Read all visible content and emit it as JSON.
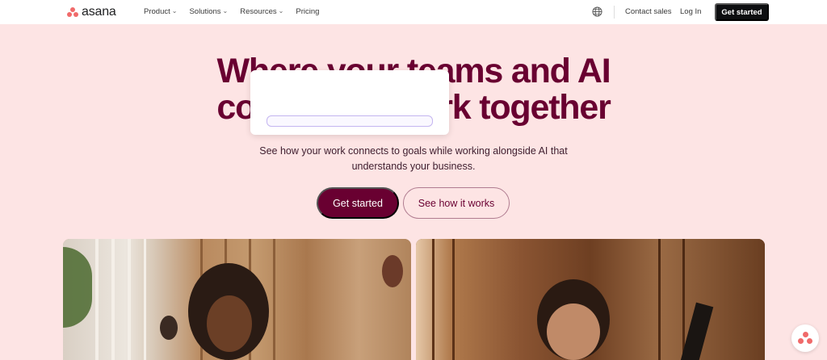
{
  "nav": {
    "logo_text": "asana",
    "links": [
      {
        "label": "Product",
        "has_dropdown": true
      },
      {
        "label": "Solutions",
        "has_dropdown": true
      },
      {
        "label": "Resources",
        "has_dropdown": true
      },
      {
        "label": "Pricing",
        "has_dropdown": false
      }
    ],
    "language_icon": "globe-icon",
    "contact_label": "Contact sales",
    "login_label": "Log In",
    "cta_label": "Get started"
  },
  "hero": {
    "title_line1": "Where your teams and AI",
    "title_line2": "coordinate work together",
    "subtitle_line1": "See how your work connects to goals while working alongside AI that",
    "subtitle_line2": "understands your business.",
    "primary_button": "Get started",
    "secondary_button": "See how it works"
  },
  "colors": {
    "background": "#fde4e4",
    "brand": "#690031",
    "logo_coral": "#f06a6a",
    "nav_cta": "#0d0e10"
  },
  "chat": {
    "icon": "asana-chat-icon"
  }
}
